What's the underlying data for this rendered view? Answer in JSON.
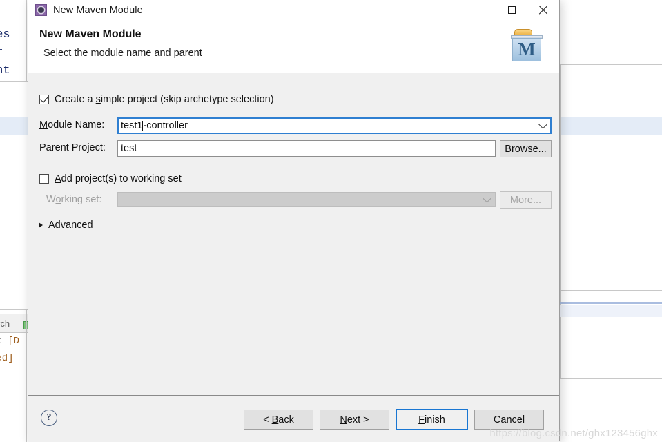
{
  "window": {
    "title": "New Maven Module",
    "app_icon": "maven-gear-icon",
    "minimize_label": "Minimize",
    "maximize_label": "Maximize",
    "close_label": "Close"
  },
  "header": {
    "title": "New Maven Module",
    "subtitle": "Select the module name and parent",
    "banner_icon": "maven-folder-icon",
    "banner_letter": "M"
  },
  "form": {
    "simple_project_checkbox": {
      "label": "Create a simple project (skip archetype selection)",
      "checked": true
    },
    "module_name": {
      "label": "Module Name:",
      "value": "test1-controller",
      "focused": true
    },
    "parent_project": {
      "label": "Parent Project:",
      "value": "test",
      "browse_label": "Browse..."
    },
    "working_set_checkbox": {
      "label": "Add project(s) to working set",
      "checked": false
    },
    "working_set": {
      "label": "Working set:",
      "value": "",
      "more_label": "More...",
      "disabled": true
    },
    "advanced": {
      "label": "Advanced",
      "expanded": false
    }
  },
  "footer": {
    "help_glyph": "?",
    "back_label": "< Back",
    "next_label": "Next >",
    "finish_label": "Finish",
    "cancel_label": "Cancel"
  },
  "watermark": {
    "text": "https://blog.csdn.net/ghx123456ghx"
  },
  "background": {
    "editor_lines": [
      "tes",
      "er",
      "int"
    ],
    "search_tab_label": "rch",
    "console_line_1_dark": "st",
    "console_line_1_orange": "[D",
    "console_line_2_orange": "zed]"
  },
  "colors": {
    "accent": "#1976d2",
    "focus_border": "#2f7fd1",
    "dialog_bg": "#f0f0f0",
    "maven_blue": "#2f5d86",
    "maven_orange": "#e8ab3c",
    "app_icon_purple": "#8a67a8"
  }
}
